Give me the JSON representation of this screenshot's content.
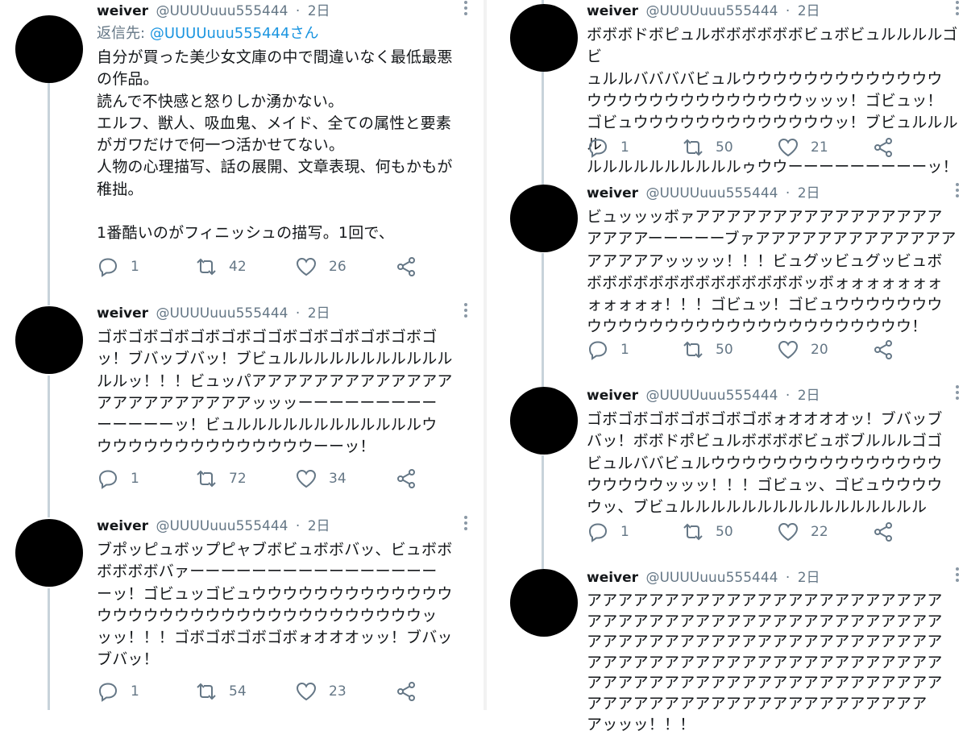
{
  "left_column": [
    {
      "name": "weiver",
      "handle": "@UUUUuuu555444",
      "time": "2日",
      "reply_label": "返信先:",
      "reply_mention": "@UUUUuuu555444さん",
      "text": "自分が買った美少女文庫の中で間違いなく最低最悪\nの作品。\n読んで不快感と怒りしか湧かない。\nエルフ、獣人、吸血鬼、メイド、全ての属性と要素\nがガワだけで何一つ活かせてない。\n人物の心理描写、話の展開、文章表現、何もかもが\n稚拙。\n\n1番酷いのがフィニッシュの描写。1回で、",
      "replies": "1",
      "retweets": "42",
      "likes": "26"
    },
    {
      "name": "weiver",
      "handle": "@UUUUuuu555444",
      "time": "2日",
      "text": "ゴボゴボゴボゴボゴボゴゴボゴボゴボゴボゴボゴ\nッ！ブバッブバッ！ブビュルルルルルルルルルルル\nルルッ！！！ビュッパアアアアアアアアアアアアア\nアアアアアアアアアアッッッーーーーーーーーー\nーーーーーッ！ビュルルルルルルルルルルルルウ\nウウウウウウウウウウウウウウーーッ！",
      "replies": "1",
      "retweets": "72",
      "likes": "34"
    },
    {
      "name": "weiver",
      "handle": "@UUUUuuu555444",
      "time": "2日",
      "text": "ブポッピュボップピャブボビュボボバッ、ビュボボ\nボボボボバァーーーーーーーーーーーーーーーー\nーッ！ゴビュッゴビュウウウウウウウウウウウウウ\nウウウウウウウウウウウウウウウウウウウウウッ\nッッ！！！ゴボゴボゴボゴボォオオオッッ！ブバッ\nブバッ！",
      "replies": "1",
      "retweets": "54",
      "likes": "23"
    }
  ],
  "right_column": [
    {
      "name": "weiver",
      "handle": "@UUUUuuu555444",
      "time": "2日",
      "text": "ボボボドボピュルボボボボボボビュボビュルルルルゴビ\nュルルババババビュルウウウウウウウウウウウウウ\nウウウウウウウウウウウウウウッッッ！ゴビュッ！\nゴビュウウウウウウウウウウウウウッ！ブビュルルルル\nルルルルルルルルルルゥウウーーーーーーーーーッ！",
      "replies": "1",
      "retweets": "50",
      "likes": "21"
    },
    {
      "name": "weiver",
      "handle": "@UUUUuuu555444",
      "time": "2日",
      "text": "ビュッッッボァアアアアアアアアアアアアアアアア\nアアアアーーーーーブァアアアアアアアアアアアアア\nアアアアアッッッッ！！！ビュグッビュグッビュボ\nボボボボボボボボボボボボボボッボォォォォォォォ\nォォォォォ！！！ゴビュッ！ゴビュウウウウウウウ\nウウウウウウウウウウウウウウウウウウウウウ！",
      "replies": "1",
      "retweets": "50",
      "likes": "20"
    },
    {
      "name": "weiver",
      "handle": "@UUUUuuu555444",
      "time": "2日",
      "text": "ゴボゴボゴボゴボゴボゴボォオオオオッ！ブバッブ\nバッ！ボボドポビュルボボボボビュボブルルルゴゴ\nビュルババビュルウウウウウウウウウウウウウウウ\nウウウウウッッッ！！！ゴビュッ、ゴビュウウウウ\nウッ、ブビュルルルルルルルルルルルルルルルル",
      "replies": "1",
      "retweets": "50",
      "likes": "22"
    },
    {
      "name": "weiver",
      "handle": "@UUUUuuu555444",
      "time": "2日",
      "text": "アアアアアアアアアアアアアアアアアアアアアアア\nアアアアアアアアアアアアアアアアアアアアアアア\nアアアアアアアアアアアアアアアアアアアアアアア\nアアアアアアアアアアアアアアアアアアアアアアア\nアアアアアアアアアアアアアアアアアアアアアアア\nアアアアアアアアアアアアアアアアアアアアアア\nアッッッ！！！",
      "replies": "",
      "retweets": "",
      "likes": ""
    }
  ]
}
